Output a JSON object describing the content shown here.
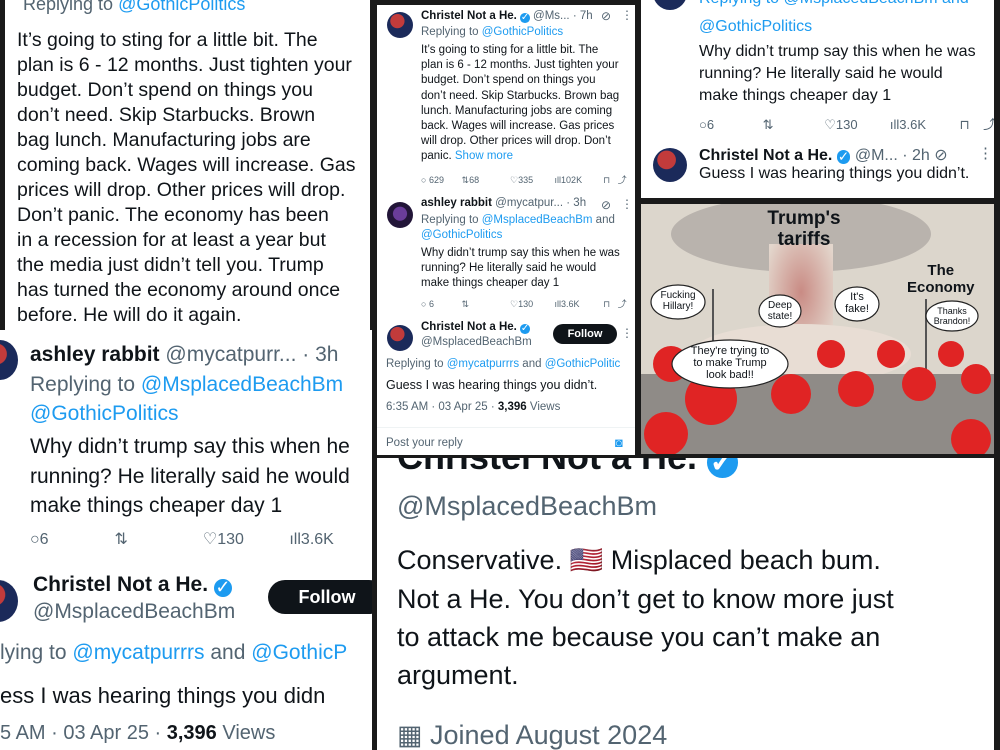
{
  "p1": {
    "replying_prefix": "Replying to ",
    "replying_handle": "@GothicPolitics",
    "body": [
      "It’s going to sting for a little bit. The",
      "plan is 6 - 12 months. Just tighten your",
      "budget. Don’t spend on things you",
      "don’t need. Skip Starbucks. Brown",
      "bag lunch. Manufacturing jobs are",
      "coming back. Wages will increase. Gas",
      "prices will drop. Other prices will drop.",
      "Don’t panic. The economy has been",
      "in a recession for at least a year but",
      "the media just didn’t tell you. Trump",
      "has turned the economy around once",
      "before. He will do it again."
    ]
  },
  "p2": {
    "t1": {
      "name": "Christel Not a He.",
      "handle": "@Ms...",
      "time": "· 7h",
      "replying_prefix": "Replying to ",
      "replying_handle": "@GothicPolitics",
      "body": [
        "It’s going to sting for a little bit. The",
        "plan is 6 - 12 months. Just tighten your",
        "budget. Don’t spend on things you",
        "don’t need. Skip Starbucks. Brown bag",
        "lunch. Manufacturing jobs are coming",
        "back. Wages will increase. Gas prices",
        "will drop. Other prices will drop. Don’t"
      ],
      "last_line": "panic.",
      "show_more": "Show more",
      "replies": "629",
      "reposts": "68",
      "likes": "335",
      "views": "102K"
    },
    "t2": {
      "name": "ashley rabbit",
      "handle": "@mycatpur...",
      "time": "· 3h",
      "replying_prefix": "Replying to ",
      "replying_handle1": "@MsplacedBeachBm",
      "replying_and": " and",
      "replying_handle2": "@GothicPolitics",
      "body": [
        "Why didn’t trump say this when he was",
        "running? He literally said he would",
        "make things cheaper day 1"
      ],
      "replies": "6",
      "likes": "130",
      "views": "3.6K"
    },
    "t3": {
      "name": "Christel Not a He.",
      "handle": "@MsplacedBeachBm",
      "follow": "Follow",
      "replying_prefix": "Replying to ",
      "replying_handle1": "@mycatpurrrs",
      "replying_and": " and ",
      "replying_handle2": "@GothicPolitic",
      "body": "Guess I was hearing things you didn’t.",
      "meta": "6:35 AM · 03 Apr 25 · ",
      "views_count": "3,396",
      "views_label": " Views"
    },
    "reply_placeholder": "Post your reply"
  },
  "p3": {
    "replying_top": "Replying to @MsplacedBeachBm and",
    "handle_line": "@GothicPolitics",
    "body": [
      "Why didn’t trump say this when he was",
      "running? He literally said he would",
      "make things cheaper day 1"
    ],
    "replies": "6",
    "likes": "130",
    "views": "3.6K",
    "t2_name": "Christel Not a He.",
    "t2_handle": "@M...",
    "t2_time": "· 2h",
    "t2_body": "Guess I was hearing things you didn’t."
  },
  "meme": {
    "title_lines": [
      "Trump's",
      "tariffs"
    ],
    "economy_lines": [
      "The",
      "Economy"
    ],
    "bubbles": {
      "hillary": [
        "Fucking",
        "Hillary!"
      ],
      "deep_state": [
        "Deep",
        "state!"
      ],
      "fake": [
        "It's",
        "fake!"
      ],
      "brandon": [
        "Thanks",
        "Brandon!"
      ],
      "trying": [
        "They're trying to",
        "to make Trump",
        "look bad!!"
      ]
    },
    "colors": {
      "sky": "#dcd6cc",
      "cloud": "#c98b84",
      "cap": "#e02424"
    }
  },
  "p5": {
    "name": "ashley rabbit",
    "handle": "@mycatpurr...",
    "time": "· 3h",
    "replying_prefix": "Replying to ",
    "replying_handle1": "@MsplacedBeachBm",
    "replying_handle2": "@GothicPolitics",
    "body": [
      "Why didn’t trump say this when he",
      "running? He literally said he would",
      "make things cheaper day 1"
    ],
    "replies": "6",
    "likes": "130",
    "views": "3.6K",
    "t2_name": "Christel Not a He.",
    "t2_handle": "@MsplacedBeachBm",
    "t2_follow": "Follow",
    "t2_replying": "lying to ",
    "t2_replying_handle1": "@mycatpurrrs",
    "t2_replying_and": " and ",
    "t2_replying_handle2": "@GothicP",
    "t2_body": "ess I was hearing things you didn",
    "t2_meta": "5 AM · 03 Apr 25 · ",
    "t2_views_count": "3,396",
    "t2_views_label": " Views"
  },
  "p6": {
    "name": "Christel Not a He.",
    "handle": "@MsplacedBeachBm",
    "flag": "🇺🇸",
    "bio_prefix": "Conservative.",
    "bio": [
      "Misplaced beach bum.",
      "Not a He. You don’t get to know more just",
      "to attack me because you can’t make an",
      "argument."
    ],
    "joined": "Joined August 2024"
  }
}
